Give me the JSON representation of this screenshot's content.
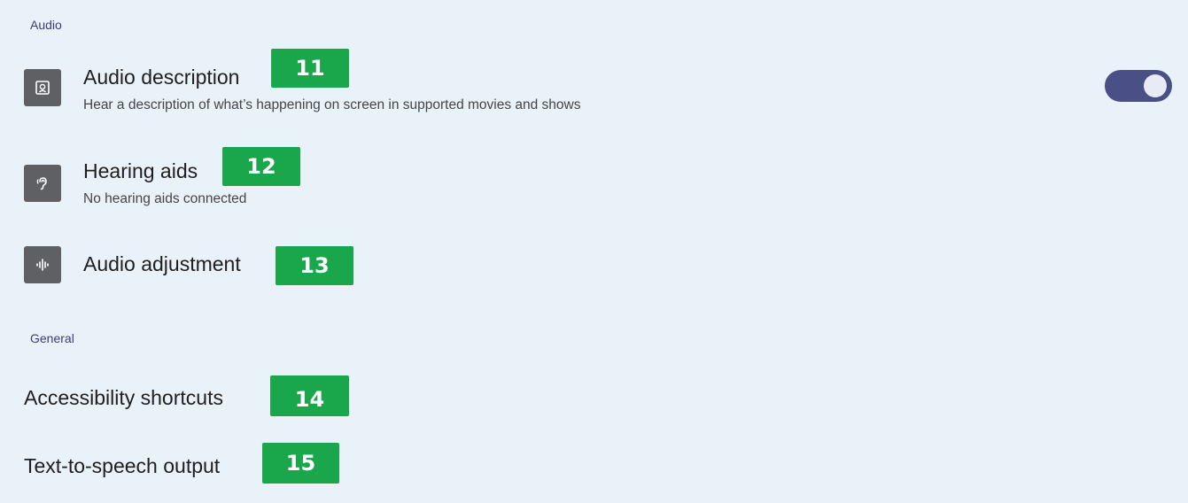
{
  "sections": {
    "audio": "Audio",
    "general": "General"
  },
  "items": {
    "audio_description": {
      "title": "Audio description",
      "subtitle": "Hear a description of what’s happening on screen in supported movies and shows",
      "badge": "11",
      "icon": "audio-description-icon",
      "toggle_on": true
    },
    "hearing_aids": {
      "title": "Hearing aids",
      "subtitle": "No hearing aids connected",
      "badge": "12",
      "icon": "hearing-aid-icon"
    },
    "audio_adjustment": {
      "title": "Audio adjustment",
      "badge": "13",
      "icon": "audio-waveform-icon"
    },
    "accessibility_shortcuts": {
      "title": "Accessibility shortcuts",
      "badge": "14"
    },
    "tts_output": {
      "title": "Text-to-speech output",
      "badge": "15"
    }
  },
  "colors": {
    "background": "#e9f1f9",
    "section_header": "#3a3f73",
    "toggle_track": "#4a4f86",
    "badge": "#1aa64a"
  }
}
